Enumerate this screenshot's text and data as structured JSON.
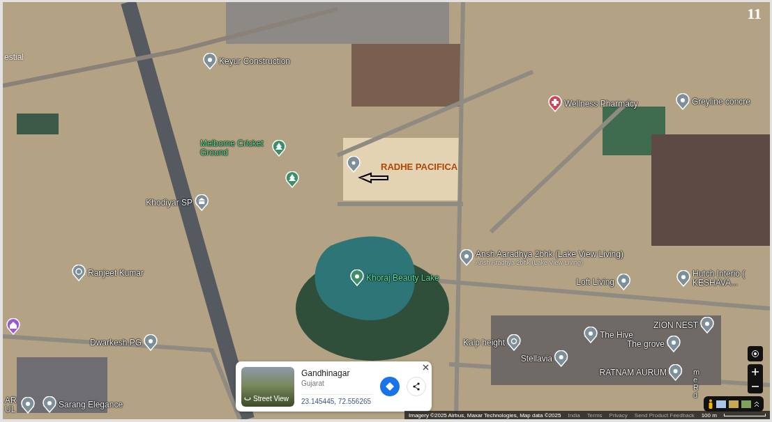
{
  "page_number": "11",
  "annotation": {
    "label": "RADHE PACIFICA"
  },
  "map_labels": [
    {
      "text": "estial"
    },
    {
      "text": "me Rd",
      "kind": "road"
    }
  ],
  "pins": [
    {
      "label": "Keyur Construction",
      "kind": "place",
      "color": "#7d8f99"
    },
    {
      "label": "Melborne Cricket Ground",
      "kind": "park",
      "color": "#3e8e68"
    },
    {
      "kind": "park",
      "color": "#3e8e68"
    },
    {
      "kind": "marker",
      "color": "#7d8f99"
    },
    {
      "label": "Khodiyar SP",
      "kind": "bank",
      "color": "#7d8f99"
    },
    {
      "label": "Wellness Pharmacy",
      "kind": "pharmacy",
      "color": "#d0445a"
    },
    {
      "label": "Greyline concre",
      "kind": "place",
      "color": "#7d8f99"
    },
    {
      "label": "Ranjeet Kumar",
      "kind": "temple",
      "color": "#7d8f99"
    },
    {
      "label": "Khoraj Beauty Lake",
      "kind": "lake",
      "color": "#3e8e68"
    },
    {
      "kind": "home",
      "color": "#9b59d0"
    },
    {
      "label": "Dwarkesh PG",
      "kind": "place",
      "color": "#7d8f99"
    },
    {
      "label": "AR UL",
      "kind": "place",
      "color": "#7d8f99"
    },
    {
      "label": "Sarang Elegance",
      "kind": "place",
      "color": "#7d8f99"
    },
    {
      "label": "Ansh Aaradhya 2bhk (Lake View Living)",
      "sublabel": "Ansh Aradhya 2bhk (Lake View Living)",
      "kind": "place",
      "color": "#7d8f99"
    },
    {
      "label": "Loft Living",
      "kind": "place",
      "color": "#7d8f99"
    },
    {
      "label": "Hutch Interio ( KESHAVA...",
      "kind": "place",
      "color": "#7d8f99"
    },
    {
      "label": "ZION NEST",
      "kind": "place",
      "color": "#7d8f99"
    },
    {
      "label": "The Hive",
      "kind": "place",
      "color": "#7d8f99"
    },
    {
      "label": "Kalp height",
      "kind": "om",
      "color": "#7d8f99"
    },
    {
      "label": "The grove",
      "kind": "place",
      "color": "#7d8f99"
    },
    {
      "label": "Stellavia",
      "kind": "place",
      "color": "#7d8f99"
    },
    {
      "label": "RATNAM AURUM",
      "kind": "place",
      "color": "#7d8f99"
    }
  ],
  "info_card": {
    "street_view": "Street View",
    "title": "Gandhinagar",
    "subtitle": "Gujarat",
    "coordinates": "23.145445, 72.556265"
  },
  "footer": {
    "attribution": "Imagery ©2025 Airbus, Maxar Technologies, Map data ©2025",
    "links": [
      "India",
      "Terms",
      "Privacy",
      "Send Product Feedback"
    ],
    "scale": "100 m"
  }
}
